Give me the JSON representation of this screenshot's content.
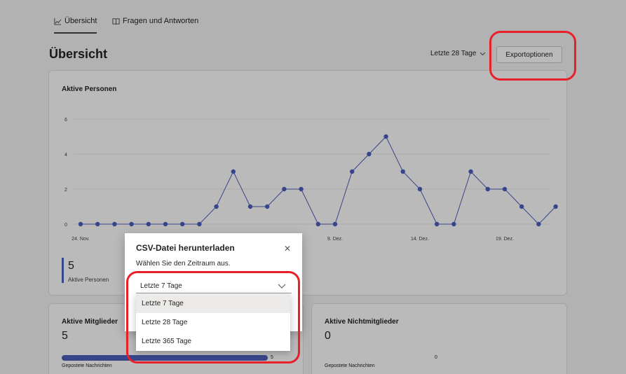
{
  "tabs": [
    {
      "label": "Übersicht",
      "icon": "chart-icon"
    },
    {
      "label": "Fragen und Antworten",
      "icon": "book-icon"
    }
  ],
  "page_title": "Übersicht",
  "range_select": {
    "value": "Letzte 28 Tage"
  },
  "export_button": {
    "label": "Exportoptionen"
  },
  "active_people_card": {
    "title": "Aktive Personen",
    "stat_value": "5",
    "stat_label": "Aktive Personen"
  },
  "chart_data": {
    "type": "line",
    "title": "",
    "ylim": [
      0,
      6
    ],
    "y_ticks": [
      "0",
      "2",
      "4",
      "6"
    ],
    "x_tick_labels": [
      "24. Nov.",
      "9. Dez.",
      "14. Dez.",
      "19. Dez."
    ],
    "grid": true,
    "series": [
      {
        "color": "#4f5fbf",
        "values": [
          0,
          0,
          0,
          0,
          0,
          0,
          0,
          0,
          1,
          3,
          1,
          1,
          2,
          2,
          0,
          0,
          3,
          4,
          5,
          3,
          2,
          0,
          0,
          3,
          2,
          2,
          1,
          0,
          1
        ]
      }
    ]
  },
  "members_card": {
    "title": "Aktive Mitglieder",
    "value": "5",
    "bar_value": "5",
    "bar_fraction": 1.0,
    "bar_label": "Gepostete Nachrichten"
  },
  "nonmembers_card": {
    "title": "Aktive Nichtmitglieder",
    "value": "0",
    "bar_value": "0",
    "bar_label": "Gepostete Nachrichten"
  },
  "modal": {
    "title": "CSV-Datei herunterladen",
    "subtitle": "Wählen Sie den Zeitraum aus.",
    "dropdown_value": "Letzte 7 Tage",
    "options": [
      "Letzte 7 Tage",
      "Letzte 28 Tage",
      "Letzte 365 Tage"
    ]
  },
  "colors": {
    "accent": "#4f5fbf",
    "highlight": "#e8202a"
  }
}
